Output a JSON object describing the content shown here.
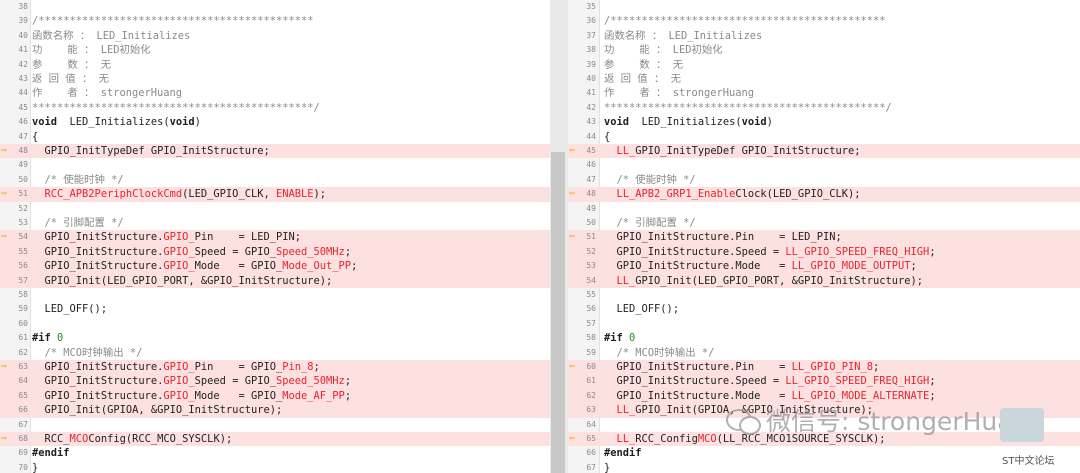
{
  "left": {
    "lines": [
      {
        "ln": "38",
        "segs": []
      },
      {
        "ln": "39",
        "segs": [
          [
            "c",
            "/********************************************"
          ]
        ]
      },
      {
        "ln": "40",
        "segs": [
          [
            "c",
            "函数名称 ： LED_Initializes"
          ]
        ]
      },
      {
        "ln": "41",
        "segs": [
          [
            "c",
            "功    能 ： LED初始化"
          ]
        ]
      },
      {
        "ln": "42",
        "segs": [
          [
            "c",
            "参    数 ： 无"
          ]
        ]
      },
      {
        "ln": "43",
        "segs": [
          [
            "c",
            "返 回 值 ： 无"
          ]
        ]
      },
      {
        "ln": "44",
        "segs": [
          [
            "c",
            "作    者 ： strongerHuang"
          ]
        ]
      },
      {
        "ln": "45",
        "segs": [
          [
            "c",
            "*********************************************/"
          ]
        ]
      },
      {
        "ln": "46",
        "segs": [
          [
            "kw",
            "void"
          ],
          [
            "",
            "  LED_Initializes("
          ],
          [
            "kw",
            "void"
          ],
          [
            "",
            ")"
          ]
        ]
      },
      {
        "ln": "47",
        "segs": [
          [
            "",
            "{"
          ]
        ]
      },
      {
        "ln": "48",
        "arrow": true,
        "diff": true,
        "segs": [
          [
            "",
            "  GPIO_InitTypeDef GPIO_InitStructure;"
          ]
        ]
      },
      {
        "ln": "49",
        "segs": []
      },
      {
        "ln": "50",
        "segs": [
          [
            "c",
            "  /* 使能时钟 */"
          ]
        ]
      },
      {
        "ln": "51",
        "arrow": true,
        "diff": true,
        "segs": [
          [
            "r",
            "  RCC_APB2PeriphClockCmd"
          ],
          [
            "",
            "(LED_GPIO_CLK, "
          ],
          [
            "r",
            "ENABLE"
          ],
          [
            "",
            ");"
          ]
        ]
      },
      {
        "ln": "52",
        "segs": []
      },
      {
        "ln": "53",
        "segs": [
          [
            "c",
            "  /* 引脚配置 */"
          ]
        ]
      },
      {
        "ln": "54",
        "arrow": true,
        "diff": true,
        "segs": [
          [
            "",
            "  GPIO_InitStructure."
          ],
          [
            "r",
            "GPIO_"
          ],
          [
            "",
            "Pin    = LED_PIN;"
          ]
        ]
      },
      {
        "ln": "55",
        "diff": true,
        "segs": [
          [
            "",
            "  GPIO_InitStructure."
          ],
          [
            "r",
            "GPIO_"
          ],
          [
            "",
            "Speed = GPIO_"
          ],
          [
            "r",
            "Speed_50MHz"
          ],
          [
            "",
            ";"
          ]
        ]
      },
      {
        "ln": "56",
        "diff": true,
        "segs": [
          [
            "",
            "  GPIO_InitStructure."
          ],
          [
            "r",
            "GPIO_"
          ],
          [
            "",
            "Mode   = GPIO_"
          ],
          [
            "r",
            "Mode_Out_PP"
          ],
          [
            "",
            ";"
          ]
        ]
      },
      {
        "ln": "57",
        "diff": true,
        "segs": [
          [
            "",
            "  GPIO_Init(LED_GPIO_PORT, &GPIO_InitStructure);"
          ]
        ]
      },
      {
        "ln": "58",
        "segs": []
      },
      {
        "ln": "59",
        "segs": [
          [
            "",
            "  LED_OFF();"
          ]
        ]
      },
      {
        "ln": "60",
        "segs": []
      },
      {
        "ln": "61",
        "segs": [
          [
            "kw",
            "#if"
          ],
          [
            "",
            " "
          ],
          [
            "n",
            "0"
          ]
        ]
      },
      {
        "ln": "62",
        "segs": [
          [
            "c",
            "  /* MCO时钟输出 */"
          ]
        ]
      },
      {
        "ln": "63",
        "arrow": true,
        "diff": true,
        "segs": [
          [
            "",
            "  GPIO_InitStructure."
          ],
          [
            "r",
            "GPIO_"
          ],
          [
            "",
            "Pin    = GPIO_"
          ],
          [
            "r",
            "Pin_8"
          ],
          [
            "",
            ";"
          ]
        ]
      },
      {
        "ln": "64",
        "diff": true,
        "segs": [
          [
            "",
            "  GPIO_InitStructure."
          ],
          [
            "r",
            "GPIO_"
          ],
          [
            "",
            "Speed = GPIO_"
          ],
          [
            "r",
            "Speed_50MHz"
          ],
          [
            "",
            ";"
          ]
        ]
      },
      {
        "ln": "65",
        "diff": true,
        "segs": [
          [
            "",
            "  GPIO_InitStructure."
          ],
          [
            "r",
            "GPIO_"
          ],
          [
            "",
            "Mode   = GPIO_"
          ],
          [
            "r",
            "Mode_AF_PP"
          ],
          [
            "",
            ";"
          ]
        ]
      },
      {
        "ln": "66",
        "diff": true,
        "segs": [
          [
            "",
            "  GPIO_Init(GPIOA, &GPIO_InitStructure);"
          ]
        ]
      },
      {
        "ln": "67",
        "segs": []
      },
      {
        "ln": "68",
        "arrow": true,
        "diff": true,
        "segs": [
          [
            "",
            "  RCC_"
          ],
          [
            "r",
            "MCO"
          ],
          [
            "",
            "Config(RCC_MCO_SYSCLK);"
          ]
        ]
      },
      {
        "ln": "69",
        "segs": [
          [
            "kw",
            "#endif"
          ]
        ]
      },
      {
        "ln": "70",
        "segs": [
          [
            "",
            "}"
          ]
        ]
      }
    ]
  },
  "right": {
    "lines": [
      {
        "ln": "35",
        "segs": []
      },
      {
        "ln": "36",
        "segs": [
          [
            "c",
            "/********************************************"
          ]
        ]
      },
      {
        "ln": "37",
        "segs": [
          [
            "c",
            "函数名称 ： LED_Initializes"
          ]
        ]
      },
      {
        "ln": "38",
        "segs": [
          [
            "c",
            "功    能 ： LED初始化"
          ]
        ]
      },
      {
        "ln": "39",
        "segs": [
          [
            "c",
            "参    数 ： 无"
          ]
        ]
      },
      {
        "ln": "40",
        "segs": [
          [
            "c",
            "返 回 值 ： 无"
          ]
        ]
      },
      {
        "ln": "41",
        "segs": [
          [
            "c",
            "作    者 ： strongerHuang"
          ]
        ]
      },
      {
        "ln": "42",
        "segs": [
          [
            "c",
            "*********************************************/"
          ]
        ]
      },
      {
        "ln": "43",
        "segs": [
          [
            "kw",
            "void"
          ],
          [
            "",
            "  LED_Initializes("
          ],
          [
            "kw",
            "void"
          ],
          [
            "",
            ")"
          ]
        ]
      },
      {
        "ln": "44",
        "segs": [
          [
            "",
            "{"
          ]
        ]
      },
      {
        "ln": "45",
        "arrow": true,
        "diff": true,
        "segs": [
          [
            "r",
            "  LL_"
          ],
          [
            "",
            "GPIO_InitTypeDef GPIO_InitStructure;"
          ]
        ]
      },
      {
        "ln": "46",
        "segs": []
      },
      {
        "ln": "47",
        "segs": [
          [
            "c",
            "  /* 使能时钟 */"
          ]
        ]
      },
      {
        "ln": "48",
        "arrow": true,
        "diff": true,
        "segs": [
          [
            "r",
            "  LL_APB2_GRP1_Enable"
          ],
          [
            "",
            "Clock(LED_GPIO_CLK);"
          ]
        ]
      },
      {
        "ln": "49",
        "segs": []
      },
      {
        "ln": "50",
        "segs": [
          [
            "c",
            "  /* 引脚配置 */"
          ]
        ]
      },
      {
        "ln": "51",
        "arrow": true,
        "diff": true,
        "segs": [
          [
            "",
            "  GPIO_InitStructure.Pin    = LED_PIN;"
          ]
        ]
      },
      {
        "ln": "52",
        "diff": true,
        "segs": [
          [
            "",
            "  GPIO_InitStructure.Speed = "
          ],
          [
            "r",
            "LL_GPIO_SPEED_FREQ_HIGH"
          ],
          [
            "",
            ";"
          ]
        ]
      },
      {
        "ln": "53",
        "diff": true,
        "segs": [
          [
            "",
            "  GPIO_InitStructure.Mode   = "
          ],
          [
            "r",
            "LL_GPIO_MODE_OUTPUT"
          ],
          [
            "",
            ";"
          ]
        ]
      },
      {
        "ln": "54",
        "diff": true,
        "segs": [
          [
            "r",
            "  LL_"
          ],
          [
            "",
            "GPIO_Init(LED_GPIO_PORT, &GPIO_InitStructure);"
          ]
        ]
      },
      {
        "ln": "55",
        "segs": []
      },
      {
        "ln": "56",
        "segs": [
          [
            "",
            "  LED_OFF();"
          ]
        ]
      },
      {
        "ln": "57",
        "segs": []
      },
      {
        "ln": "58",
        "segs": [
          [
            "kw",
            "#if"
          ],
          [
            "",
            " "
          ],
          [
            "n",
            "0"
          ]
        ]
      },
      {
        "ln": "59",
        "segs": [
          [
            "c",
            "  /* MCO时钟输出 */"
          ]
        ]
      },
      {
        "ln": "60",
        "arrow": true,
        "diff": true,
        "segs": [
          [
            "",
            "  GPIO_InitStructure.Pin    = "
          ],
          [
            "r",
            "LL_GPIO_PIN_8"
          ],
          [
            "",
            ";"
          ]
        ]
      },
      {
        "ln": "61",
        "diff": true,
        "segs": [
          [
            "",
            "  GPIO_InitStructure.Speed = "
          ],
          [
            "r",
            "LL_GPIO_SPEED_FREQ_HIGH"
          ],
          [
            "",
            ";"
          ]
        ]
      },
      {
        "ln": "62",
        "diff": true,
        "segs": [
          [
            "",
            "  GPIO_InitStructure.Mode   = "
          ],
          [
            "r",
            "LL_GPIO_MODE_ALTERNATE"
          ],
          [
            "",
            ";"
          ]
        ]
      },
      {
        "ln": "63",
        "diff": true,
        "segs": [
          [
            "r",
            "  LL_"
          ],
          [
            "",
            "GPIO_Init(GPIOA, &GPIO_InitStructure);"
          ]
        ]
      },
      {
        "ln": "64",
        "segs": []
      },
      {
        "ln": "65",
        "arrow": true,
        "diff": true,
        "segs": [
          [
            "r",
            "  LL_"
          ],
          [
            "",
            "RCC_Config"
          ],
          [
            "r",
            "MCO"
          ],
          [
            "",
            "(LL_RCC_MCO1SOURCE_SYSCLK);"
          ]
        ]
      },
      {
        "ln": "66",
        "segs": [
          [
            "kw",
            "#endif"
          ]
        ]
      },
      {
        "ln": "67",
        "segs": [
          [
            "",
            "}"
          ]
        ]
      }
    ]
  },
  "arrow_glyphs": {
    "left": "⇨",
    "right": "⇦"
  },
  "colors": {
    "diff_bg": "#fde0e0",
    "red_token": "#e8242e",
    "comment": "#8a8a8a",
    "arrow": "#e4a400"
  },
  "watermark": {
    "text": "微信号: strongerHuang",
    "icon": "wechat-icon"
  },
  "site_caption": "ST中文论坛"
}
